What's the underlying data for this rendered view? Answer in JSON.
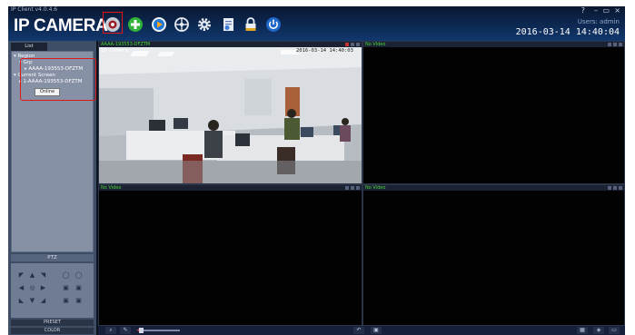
{
  "app": {
    "version": "IP Client v4.0.4.6",
    "logo": "IP CAMERA"
  },
  "toolbar": {
    "buttons": [
      {
        "name": "monitor-button",
        "icon": "camera-view-icon"
      },
      {
        "name": "add-device-button",
        "icon": "plus-circle-icon"
      },
      {
        "name": "playback-button",
        "icon": "play-circle-icon"
      },
      {
        "name": "ptz-control-button",
        "icon": "steering-wheel-icon"
      },
      {
        "name": "settings-button",
        "icon": "gear-icon"
      },
      {
        "name": "log-button",
        "icon": "document-icon"
      },
      {
        "name": "lock-button",
        "icon": "lock-icon"
      },
      {
        "name": "exit-button",
        "icon": "power-icon"
      }
    ],
    "window_controls": [
      "?",
      "–",
      "▭",
      "×"
    ],
    "user": "Users: admin",
    "datetime": "2016-03-14  14:40:04"
  },
  "left": {
    "list_tab": "List",
    "tree": {
      "region": "Region",
      "group": "Grp",
      "device": "AAAA-193553-DFZTM",
      "current_screen": "Current Screen",
      "current_device": "1-AAAA-193553-DFZTM",
      "online": "Online"
    },
    "ptz_title": "PTZ",
    "preset": "PRESET",
    "color": "COLOR"
  },
  "channels": [
    {
      "label": "AAAA-193553-DFZTM",
      "osd_name": "IP Camera",
      "osd_time": "2016-03-14  14:40:03"
    },
    {
      "label": "No Video"
    },
    {
      "label": "No Video"
    },
    {
      "label": "No Video"
    }
  ],
  "colors": {
    "accent_red": "#e01818",
    "label_green": "#4cd83a",
    "titlebar": "#0d2a55",
    "panel": "#3e4e66"
  }
}
